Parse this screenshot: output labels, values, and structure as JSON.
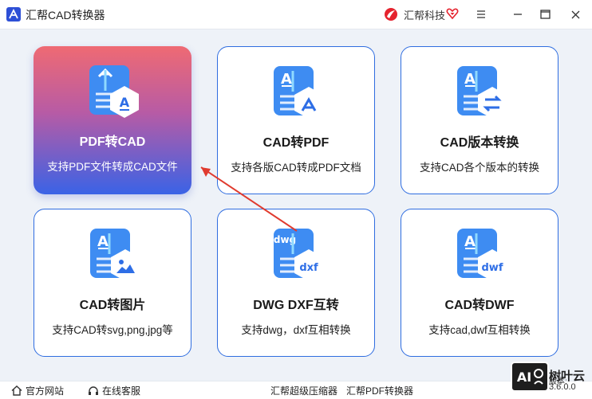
{
  "window": {
    "title": "汇帮CAD转换器",
    "brand": "汇帮科技",
    "controls": [
      "menu-icon",
      "minimize-icon",
      "maximize-icon",
      "close-icon"
    ]
  },
  "cards": [
    {
      "title": "PDF转CAD",
      "desc": "支持PDF文件转成CAD文件",
      "icon": "pdf-to-cad-icon",
      "active": true
    },
    {
      "title": "CAD转PDF",
      "desc": "支持各版CAD转成PDF文档",
      "icon": "cad-to-pdf-icon"
    },
    {
      "title": "CAD版本转换",
      "desc": "支持CAD各个版本的转换",
      "icon": "cad-version-icon"
    },
    {
      "title": "CAD转图片",
      "desc": "支持CAD转svg,png,jpg等",
      "icon": "cad-to-image-icon"
    },
    {
      "title": "DWG DXF互转",
      "desc": "支持dwg，dxf互相转换",
      "icon": "dwg-dxf-icon",
      "badge_top": "dwg",
      "badge_bottom": "dxf"
    },
    {
      "title": "CAD转DWF",
      "desc": "支持cad,dwf互相转换",
      "icon": "cad-to-dwf-icon",
      "badge_bottom": "dwf"
    }
  ],
  "footer": {
    "home": "官方网站",
    "service": "在线客服",
    "zip": "汇帮超级压缩器",
    "pdf": "汇帮PDF转换器",
    "version_label": "版本:",
    "version": "3.6.0.0"
  },
  "watermark": {
    "box": "AI",
    "text": "树叶云"
  },
  "colors": {
    "accent": "#2f6de0",
    "active_top": "#ef6a73",
    "active_bottom": "#3a63e6",
    "arrow": "#e03b2f"
  }
}
